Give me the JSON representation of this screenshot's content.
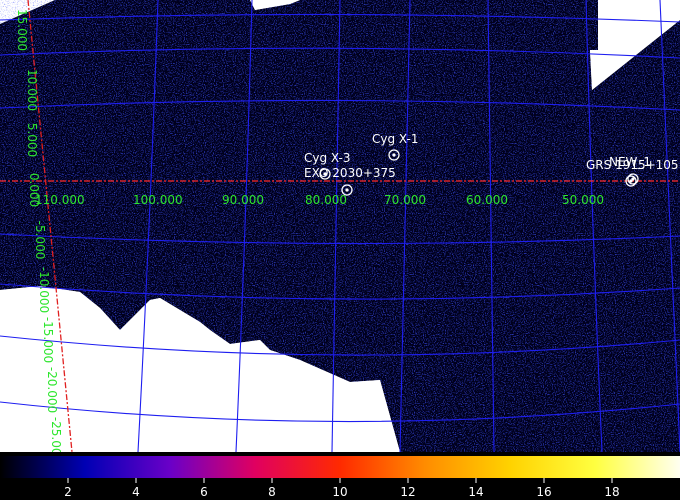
{
  "image": {
    "colors": {
      "background": "#ffffff",
      "exposure": "#01011a",
      "noise_dark": "#0a0a6e",
      "noise_bright": "#1f2be0",
      "grid": "#1e1ef0",
      "equator": "#ff2a2a",
      "meridian": "#e02020",
      "axis_labels": "#2ee62e",
      "source_label": "#ffffff"
    }
  },
  "axes": {
    "longitude_labels": [
      "110.000",
      "100.000",
      "90.000",
      "80.000",
      "70.000",
      "60.000",
      "50.000"
    ],
    "latitude_labels": [
      "15.000",
      "10.000",
      "5.000",
      "0.000",
      "-5.000",
      "-10.000",
      "-15.000",
      "-20.000",
      "-25.000"
    ]
  },
  "sources": [
    {
      "label": "Cyg X-1",
      "marker": "circle-dot"
    },
    {
      "label": "Cyg X-3",
      "marker": "circle-dot"
    },
    {
      "label": "EXO 2030+375",
      "marker": "circle-dot"
    },
    {
      "label": "GRS 1915+105",
      "marker": "circle-dot"
    },
    {
      "label": "NEW_1",
      "marker": "circle-dot"
    }
  ],
  "colorbar": {
    "ticks": [
      "2",
      "4",
      "6",
      "8",
      "10",
      "12",
      "14",
      "16",
      "18"
    ],
    "tick_values": [
      2,
      4,
      6,
      8,
      10,
      12,
      14,
      16,
      18
    ],
    "range": [
      0,
      20
    ],
    "colormap_stops": [
      "#000000",
      "#0000b4",
      "#6a00c8",
      "#e00060",
      "#ff2a00",
      "#ff8c00",
      "#ffd200",
      "#ffff40",
      "#fffff0"
    ]
  }
}
